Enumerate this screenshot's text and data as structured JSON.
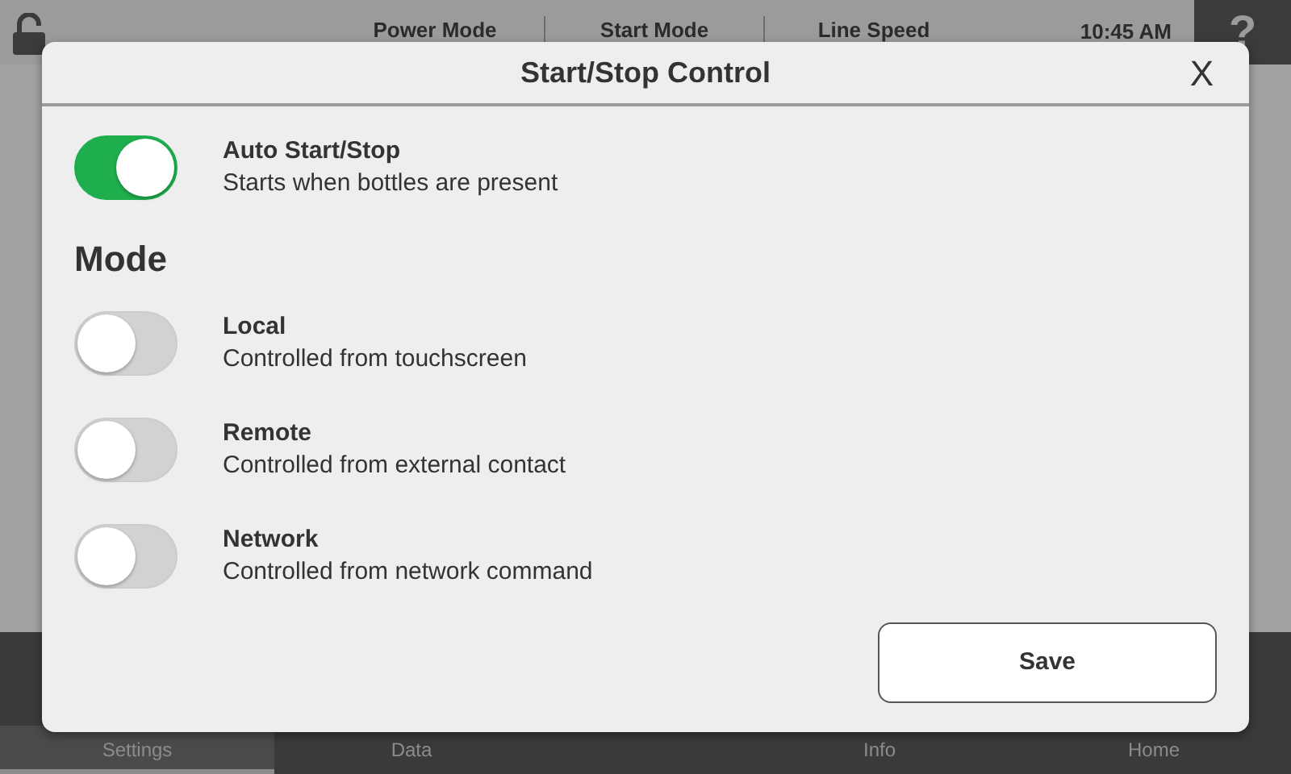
{
  "top_bar": {
    "labels": [
      "Power Mode",
      "Start Mode",
      "Line Speed"
    ],
    "time": "10:45 AM",
    "help": "?"
  },
  "bottom_nav": [
    {
      "label": "Settings",
      "selected": true
    },
    {
      "label": "Data",
      "selected": false
    },
    {
      "label": "Info",
      "selected": false
    },
    {
      "label": "Home",
      "selected": false
    }
  ],
  "dialog": {
    "title": "Start/Stop Control",
    "close": "X",
    "auto": {
      "title": "Auto Start/Stop",
      "description": "Starts when bottles are present",
      "on": true
    },
    "section_title": "Mode",
    "modes": [
      {
        "title": "Local",
        "description": "Controlled from touchscreen",
        "on": false
      },
      {
        "title": "Remote",
        "description": "Controlled from external contact",
        "on": false
      },
      {
        "title": "Network",
        "description": "Controlled from network command",
        "on": false
      }
    ],
    "save": "Save"
  }
}
